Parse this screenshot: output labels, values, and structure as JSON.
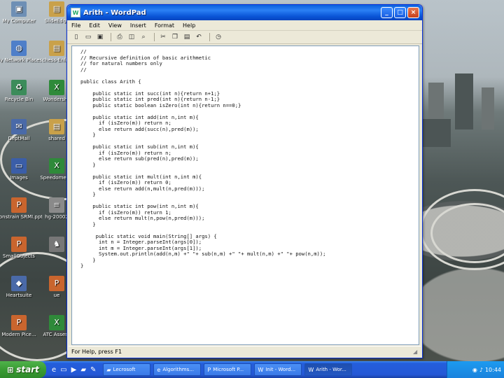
{
  "window": {
    "title": "Arith - WordPad",
    "minimize_label": "_",
    "maximize_label": "□",
    "close_label": "×"
  },
  "menu": [
    "File",
    "Edit",
    "View",
    "Insert",
    "Format",
    "Help"
  ],
  "toolbar_icons": [
    "new-icon",
    "open-icon",
    "save-icon",
    "print-icon",
    "print-preview-icon",
    "find-icon",
    "cut-icon",
    "copy-icon",
    "paste-icon",
    "undo-icon",
    "date-time-icon"
  ],
  "document": {
    "lines": [
      "//",
      "// Recursive definition of basic arithmetic",
      "// for natural numbers only",
      "//",
      "",
      "public class Arith {",
      "",
      "    public static int succ(int n){return n+1;}",
      "    public static int pred(int n){return n-1;}",
      "    public static boolean isZero(int n){return n==0;}",
      "",
      "    public static int add(int n,int m){",
      "      if (isZero(m)) return n;",
      "      else return add(succ(n),pred(m));",
      "    }",
      "",
      "    public static int sub(int n,int m){",
      "      if (isZero(m)) return n;",
      "      else return sub(pred(n),pred(m));",
      "    }",
      "",
      "    public static int mult(int n,int m){",
      "      if (isZero(m)) return 0;",
      "      else return add(n,mult(n,pred(m)));",
      "    }",
      "",
      "    public static int pow(int n,int m){",
      "      if (isZero(m)) return 1;",
      "      else return mult(n,pow(n,pred(m)));",
      "    }",
      "",
      "     public static void main(String[] args) {",
      "      int n = Integer.parseInt(args[0]);",
      "      int m = Integer.parseInt(args[1]);",
      "      System.out.println(add(n,m) +\" \"+ sub(n,m) +\" \"+ mult(n,m) +\" \"+ pow(n,m));",
      "    }",
      "}"
    ]
  },
  "statusbar": {
    "text": "For Help, press F1"
  },
  "desktop_icons": [
    {
      "label": "My Computer",
      "icon": "computer-icon",
      "color": "#6e8fb5"
    },
    {
      "label": "SlideEdge",
      "icon": "pdf-icon",
      "color": "#c9a14a"
    },
    {
      "label": "My Network Places",
      "icon": "network-icon",
      "color": "#4f7fc9"
    },
    {
      "label": "chess-Enlist",
      "icon": "pdf-icon",
      "color": "#c9a14a"
    },
    {
      "label": "Recycle Bin",
      "icon": "recycle-bin-icon",
      "color": "#3c8c5a"
    },
    {
      "label": "Wondersha",
      "icon": "excel-icon",
      "color": "#2f8a3a"
    },
    {
      "label": "DeptMail",
      "icon": "mail-icon",
      "color": "#4a6aa8"
    },
    {
      "label": "shared",
      "icon": "pdf-icon",
      "color": "#c9a14a"
    },
    {
      "label": "Images",
      "icon": "window-icon",
      "color": "#3b5ea8"
    },
    {
      "label": "Speedometer",
      "icon": "excel-icon",
      "color": "#2f8a3a"
    },
    {
      "label": "Constrain SRMI.ppt",
      "icon": "ppt-icon",
      "color": "#c9652e"
    },
    {
      "label": "hg-20002",
      "icon": "document-icon",
      "color": "#8a8a8a"
    },
    {
      "label": "SmallObjects",
      "icon": "ppt-icon",
      "color": "#c9652e"
    },
    {
      "label": "",
      "icon": "chess-icon",
      "color": "#777"
    },
    {
      "label": "Heartsuite",
      "icon": "app-icon",
      "color": "#4a6aa8"
    },
    {
      "label": "ue",
      "icon": "ppt-icon",
      "color": "#c9652e"
    },
    {
      "label": "Modern Pice...",
      "icon": "ppt-icon",
      "color": "#c9652e"
    },
    {
      "label": "ATC Assess",
      "icon": "excel-icon",
      "color": "#2f8a3a"
    }
  ],
  "taskbar": {
    "start_label": "start",
    "quick_launch": [
      "ie-icon",
      "show-desktop-icon",
      "media-icon",
      "folder-icon",
      "paint-icon"
    ],
    "tasks": [
      {
        "label": "Lecrosoft",
        "icon": "folder-icon",
        "active": false
      },
      {
        "label": "Algorithms...",
        "icon": "ie-icon",
        "active": false
      },
      {
        "label": "Microsoft P...",
        "icon": "ppt-icon",
        "active": false
      },
      {
        "label": "Init - Word...",
        "icon": "wordpad-icon",
        "active": false
      },
      {
        "label": "Arith - Wor...",
        "icon": "wordpad-icon",
        "active": true
      }
    ],
    "clock": "10:44"
  }
}
